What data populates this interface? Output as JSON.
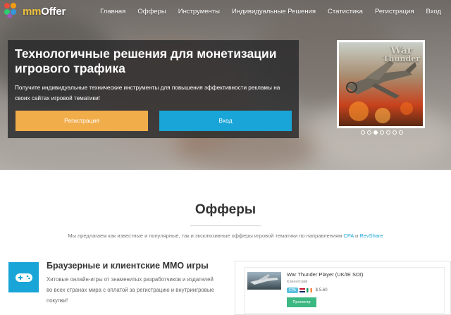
{
  "brand": {
    "logo_prefix": "mm",
    "logo_name": "Offer"
  },
  "nav": {
    "items": [
      "Главная",
      "Офферы",
      "Инструменты",
      "Индивидуальные Решения",
      "Статистика",
      "Регистрация",
      "Вход"
    ]
  },
  "hero": {
    "title": "Технологичные решения для монетизации игрового трафика",
    "text": "Получите индивидуальные технические инструменты для повышения эффективности рекламы на своих сайтах игровой тематики!",
    "register_label": "Регистрация",
    "login_label": "Вход"
  },
  "slider": {
    "brand_top": "War",
    "brand_bottom": "Thunder",
    "dot_count": 7,
    "active_index": 2
  },
  "offers_section": {
    "title": "Офферы",
    "subtitle_before": "Мы предлагаем как известные и популярные, так и эксклюзивные офферы игровой тематики по направлениям ",
    "subtitle_cpa": "CPA",
    "subtitle_and": " и ",
    "subtitle_revshare": "RevShare"
  },
  "category": {
    "title": "Браузерные и клиентские ММО игры",
    "text": "Хитовые онлайн-игры от знаменитых разработчиков и издателей во всех странах мира с оплатой за регистрацию и внутриигровые покупки!"
  },
  "offer": {
    "name": "War Thunder Player (UK/IE SOI)",
    "type": "Клиентский",
    "badge": "CPA",
    "price": "$ 5.60",
    "view_label": "Просмотр"
  },
  "colors": {
    "accent_orange": "#f2ad4b",
    "accent_blue": "#19a5d7",
    "accent_green": "#3cb883"
  }
}
